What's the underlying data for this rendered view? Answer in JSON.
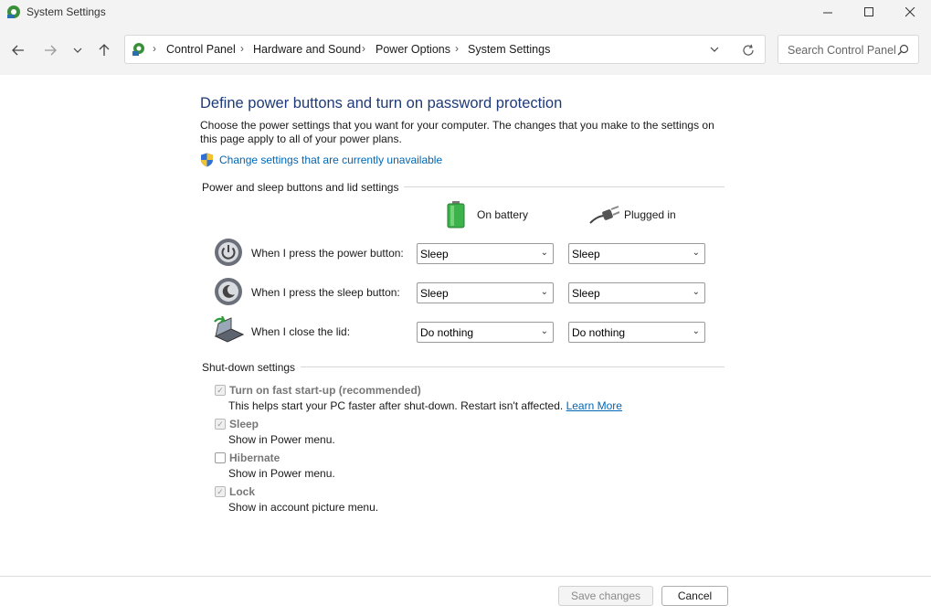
{
  "window": {
    "title": "System Settings",
    "minimize_icon": "minimize-icon",
    "maximize_icon": "maximize-icon",
    "close_icon": "close-icon"
  },
  "nav": {
    "breadcrumbs": [
      "Control Panel",
      "Hardware and Sound",
      "Power Options",
      "System Settings"
    ],
    "search_placeholder": "Search Control Panel"
  },
  "main": {
    "heading": "Define power buttons and turn on password protection",
    "description": "Choose the power settings that you want for your computer. The changes that you make to the settings on this page apply to all of your power plans.",
    "change_settings_link": "Change settings that are currently unavailable",
    "power_section": {
      "label": "Power and sleep buttons and lid settings",
      "col_battery": "On battery",
      "col_plugged": "Plugged in",
      "rows": [
        {
          "label": "When I press the power button:",
          "battery": "Sleep",
          "plugged": "Sleep"
        },
        {
          "label": "When I press the sleep button:",
          "battery": "Sleep",
          "plugged": "Sleep"
        },
        {
          "label": "When I close the lid:",
          "battery": "Do nothing",
          "plugged": "Do nothing"
        }
      ]
    },
    "shutdown_section": {
      "label": "Shut-down settings",
      "options": [
        {
          "label": "Turn on fast start-up (recommended)",
          "desc": "This helps start your PC faster after shut-down. Restart isn't affected.",
          "link": "Learn More",
          "checked": true
        },
        {
          "label": "Sleep",
          "desc": "Show in Power menu.",
          "checked": true
        },
        {
          "label": "Hibernate",
          "desc": "Show in Power menu.",
          "checked": false
        },
        {
          "label": "Lock",
          "desc": "Show in account picture menu.",
          "checked": true
        }
      ]
    }
  },
  "footer": {
    "save_label": "Save changes",
    "cancel_label": "Cancel"
  },
  "colors": {
    "heading": "#1e3a78",
    "link": "#0066b4",
    "chrome": "#f3f3f3"
  }
}
